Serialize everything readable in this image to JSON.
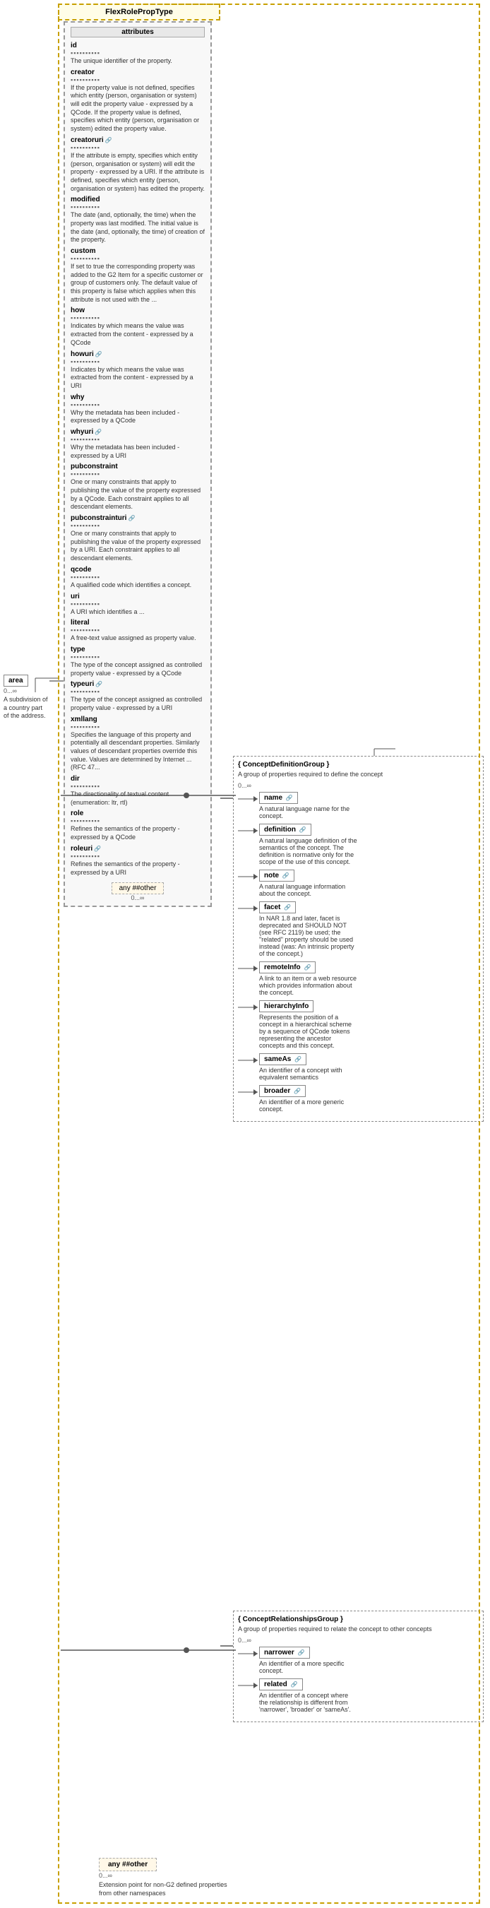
{
  "title": "FlexRolePropType",
  "attributes": {
    "label": "attributes",
    "items": [
      {
        "name": "id",
        "dots": "▪▪▪▪▪▪▪▪▪▪",
        "desc": "The unique identifier of the property.",
        "hasUri": false
      },
      {
        "name": "creator",
        "dots": "▪▪▪▪▪▪▪▪▪▪",
        "desc": "If the property value is not defined, specifies which entity (person, organisation or system) will edit the property value - expressed by a QCode. If the property value is defined, specifies which entity (person, organisation or system) edited the property value.",
        "hasUri": false
      },
      {
        "name": "creatoruri",
        "dots": "▪▪▪▪▪▪▪▪▪▪",
        "desc": "If the attribute is empty, specifies which entity (person, organisation or system) will edit the property - expressed by a URI. If the attribute is defined, specifies which entity (person, organisation or system) has edited the property.",
        "hasUri": true
      },
      {
        "name": "modified",
        "dots": "▪▪▪▪▪▪▪▪▪▪",
        "desc": "The date (and, optionally, the time) when the property was last modified. The initial value is the date (and, optionally, the time) of creation of the property.",
        "hasUri": false
      },
      {
        "name": "custom",
        "dots": "▪▪▪▪▪▪▪▪▪▪",
        "desc": "If set to true the corresponding property was added to the G2 Item for a specific customer or group of customers only. The default value of this property is false which applies when this attribute is not used with the ...",
        "hasUri": false
      },
      {
        "name": "how",
        "dots": "▪▪▪▪▪▪▪▪▪▪",
        "desc": "Indicates by which means the value was extracted from the content - expressed by a QCode",
        "hasUri": false
      },
      {
        "name": "howuri",
        "dots": "▪▪▪▪▪▪▪▪▪▪",
        "desc": "Indicates by which means the value was extracted from the content - expressed by a URI",
        "hasUri": true
      },
      {
        "name": "why",
        "dots": "▪▪▪▪▪▪▪▪▪▪",
        "desc": "Why the metadata has been included - expressed by a QCode",
        "hasUri": false
      },
      {
        "name": "whyuri",
        "dots": "▪▪▪▪▪▪▪▪▪▪",
        "desc": "Why the metadata has been included - expressed by a URI",
        "hasUri": true
      },
      {
        "name": "pubconstraint",
        "dots": "▪▪▪▪▪▪▪▪▪▪",
        "desc": "One or many constraints that apply to publishing the value of the property expressed by a QCode. Each constraint applies to all descendant elements.",
        "hasUri": false
      },
      {
        "name": "pubconstrainturi",
        "dots": "▪▪▪▪▪▪▪▪▪▪",
        "desc": "One or many constraints that apply to publishing the value of the property expressed by a URI. Each constraint applies to all descendant elements.",
        "hasUri": true
      },
      {
        "name": "qcode",
        "dots": "▪▪▪▪▪▪▪▪▪▪",
        "desc": "A qualified code which identifies a concept.",
        "hasUri": false
      },
      {
        "name": "uri",
        "dots": "▪▪▪▪▪▪▪▪▪▪",
        "desc": "A URI which identifies a ...",
        "hasUri": false
      },
      {
        "name": "literal",
        "dots": "▪▪▪▪▪▪▪▪▪▪",
        "desc": "A free-text value assigned as property value.",
        "hasUri": false
      },
      {
        "name": "type",
        "dots": "▪▪▪▪▪▪▪▪▪▪",
        "desc": "The type of the concept assigned as controlled property value - expressed by a QCode",
        "hasUri": false
      },
      {
        "name": "typeuri",
        "dots": "▪▪▪▪▪▪▪▪▪▪",
        "desc": "The type of the concept assigned as controlled property value - expressed by a URI",
        "hasUri": true
      },
      {
        "name": "xmllang",
        "dots": "▪▪▪▪▪▪▪▪▪▪",
        "desc": "Specifies the language of this property and potentially all descendant properties. Similarly values of descendant properties override this value. Values are determined by Internet ...(RFC 47...",
        "hasUri": false
      },
      {
        "name": "dir",
        "dots": "▪▪▪▪▪▪▪▪▪▪",
        "desc": "The directionality of textual content (enumeration: ltr, rtl)",
        "hasUri": false
      },
      {
        "name": "role",
        "dots": "▪▪▪▪▪▪▪▪▪▪",
        "desc": "Refines the semantics of the property - expressed by a QCode",
        "hasUri": false
      },
      {
        "name": "roleuri",
        "dots": "▪▪▪▪▪▪▪▪▪▪",
        "desc": "Refines the semantics of the property - expressed by a URI",
        "hasUri": true
      }
    ],
    "anyOther": {
      "label": "any ##other",
      "mult": "0...∞"
    }
  },
  "leftElement": {
    "name": "area",
    "dots": "▪▪▪▪▪▪▪▪▪▪",
    "desc": "A subdivision of a country part of the address.",
    "mult": "0...∞"
  },
  "rightGroups": [
    {
      "id": "conceptDefinitionGroup",
      "name": "{ ConceptDefinitionGroup }",
      "mult1": "——●●●●",
      "mult2": "0...∞",
      "desc": "A group of properties required to define the concept",
      "elements": [
        {
          "name": "name",
          "hasUri": true,
          "desc": "A natural language name for the concept."
        },
        {
          "name": "definition",
          "hasUri": true,
          "desc": "A natural language definition of the semantics of the concept. The definition is normative only for the scope of the use of this concept."
        },
        {
          "name": "note",
          "hasUri": true,
          "desc": "A natural language information about the concept."
        },
        {
          "name": "facet",
          "hasUri": true,
          "desc": "In NAR 1.8 and later, facet is deprecated and SHOULD NOT (see RFC 2119) be used; the \"related\" property should be used instead (was: An intrinsic property of the concept.)"
        },
        {
          "name": "remoteInfo",
          "hasUri": true,
          "desc": "A link to an item or a web resource which provides information about the concept."
        },
        {
          "name": "hierarchyInfo",
          "hasUri": false,
          "desc": "Represents the position of a concept in a hierarchical scheme by a sequence of QCode tokens representing the ancestor concepts and this concept."
        },
        {
          "name": "sameAs",
          "hasUri": true,
          "desc": "An identifier of a concept with equivalent semantics"
        },
        {
          "name": "broader",
          "hasUri": true,
          "desc": "An identifier of a more generic concept."
        }
      ]
    },
    {
      "id": "conceptRelationshipsGroup",
      "name": "{ ConceptRelationshipsGroup }",
      "mult1": "——●●●●",
      "mult2": "0...∞",
      "desc": "A group of properties required to relate the concept to other concepts",
      "elements": [
        {
          "name": "narrower",
          "hasUri": true,
          "desc": "An identifier of a more specific concept."
        },
        {
          "name": "related",
          "hasUri": true,
          "desc": "An identifier of a concept where the relationship is different from 'narrower', 'broader' or 'sameAs'."
        }
      ]
    }
  ],
  "bottomAnyOther": {
    "label": "any ##other",
    "mult": "0...∞",
    "desc": "Extension point for non-G2 defined properties from other namespaces"
  }
}
